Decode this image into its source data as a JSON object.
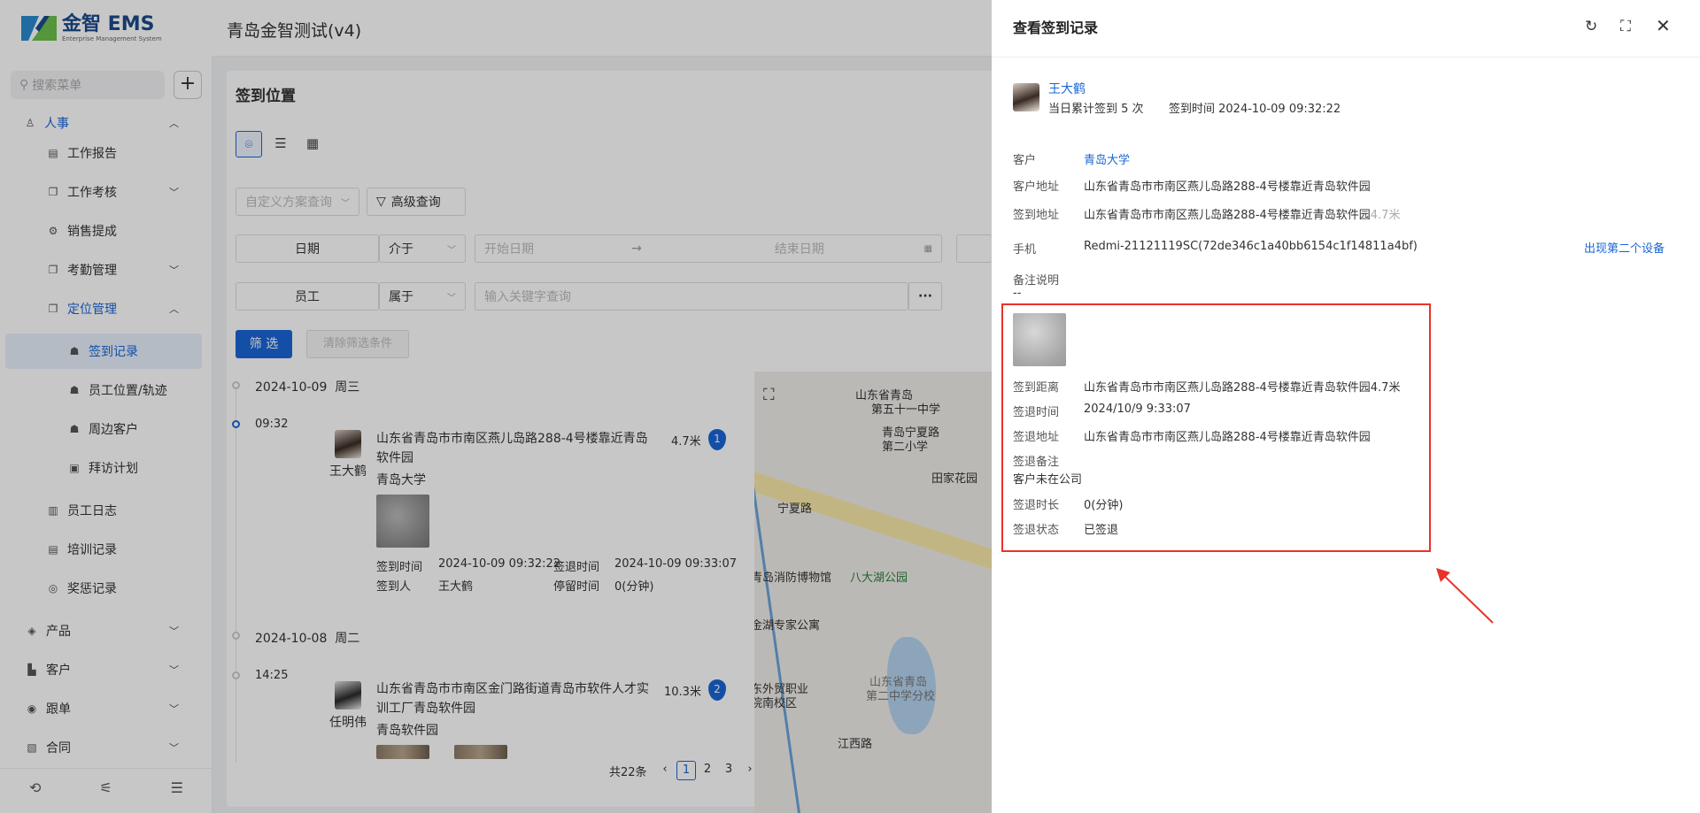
{
  "app": {
    "logo_main": "金智 EMS",
    "logo_sub": "Enterprise Management System",
    "tenant": "青岛金智测试(v4)"
  },
  "sidebar": {
    "search_placeholder": "搜索菜单",
    "add_label": "+",
    "items": [
      {
        "label": "人事",
        "level": 1,
        "expanded": true
      },
      {
        "label": "工作报告",
        "level": 2
      },
      {
        "label": "工作考核",
        "level": 2,
        "has_children": true
      },
      {
        "label": "销售提成",
        "level": 2
      },
      {
        "label": "考勤管理",
        "level": 2,
        "has_children": true
      },
      {
        "label": "定位管理",
        "level": 2,
        "expanded": true
      },
      {
        "label": "签到记录",
        "level": 3,
        "active": true
      },
      {
        "label": "员工位置/轨迹",
        "level": 3
      },
      {
        "label": "周边客户",
        "level": 3
      },
      {
        "label": "拜访计划",
        "level": 3
      },
      {
        "label": "员工日志",
        "level": 2
      },
      {
        "label": "培训记录",
        "level": 2
      },
      {
        "label": "奖惩记录",
        "level": 2
      },
      {
        "label": "产品",
        "level": 1,
        "has_children": true
      },
      {
        "label": "客户",
        "level": 1,
        "has_children": true
      },
      {
        "label": "跟单",
        "level": 1,
        "has_children": true
      },
      {
        "label": "合同",
        "level": 1,
        "has_children": true
      }
    ]
  },
  "page": {
    "title": "签到位置",
    "filters": {
      "scheme_placeholder": "自定义方案查询",
      "advanced": "高级查询",
      "date_label": "日期",
      "date_op": "介于",
      "start_ph": "开始日期",
      "end_ph": "结束日期",
      "emp_label": "员工",
      "emp_op": "属于",
      "kw_ph": "输入关键字查询",
      "more": "···"
    },
    "filter_btn": "筛 选",
    "clear_btn": "清除筛选条件"
  },
  "timeline": {
    "day1": {
      "date": "2024-10-09",
      "weekday": "周三"
    },
    "rec1": {
      "time": "09:32",
      "name": "王大鹤",
      "addr": "山东省青岛市市南区燕儿岛路288-4号楼靠近青岛软件园",
      "dist": "4.7米",
      "badge": "1",
      "customer": "青岛大学",
      "checkin_label": "签到时间",
      "checkin_val": "2024-10-09 09:32:22",
      "checkout_label": "签退时间",
      "checkout_val": "2024-10-09 09:33:07",
      "person_label": "签到人",
      "person_val": "王大鹤",
      "stay_label": "停留时间",
      "stay_val": "0(分钟)"
    },
    "day2": {
      "date": "2024-10-08",
      "weekday": "周二"
    },
    "rec2": {
      "time": "14:25",
      "name": "任明伟",
      "addr": "山东省青岛市市南区金门路街道青岛市软件人才实训工厂青岛软件园",
      "dist": "10.3米",
      "badge": "2",
      "customer": "青岛软件园"
    }
  },
  "map": {
    "labels": [
      "山东省青岛",
      "第五十一中学",
      "青岛宁夏路",
      "第二小学",
      "田家花园",
      "宁夏路",
      "青岛消防博物馆",
      "八大湖公园",
      "金湖专家公寓",
      "东外贸职业",
      "院南校区",
      "山东省青岛",
      "第二中学分校",
      "江西路"
    ],
    "road_label": "宁夏路"
  },
  "pager": {
    "total": "共22条",
    "pages": [
      "1",
      "2",
      "3"
    ],
    "current": "1",
    "prev": "‹",
    "next": "›"
  },
  "drawer": {
    "title": "查看签到记录",
    "name": "王大鹤",
    "summary": "当日累计签到 5 次",
    "checkin": "签到时间 2024-10-09 09:32:22",
    "rows": {
      "customer_label": "客户",
      "customer_val": "青岛大学",
      "cust_addr_label": "客户地址",
      "cust_addr_val": "山东省青岛市市南区燕儿岛路288-4号楼靠近青岛软件园",
      "sign_addr_label": "签到地址",
      "sign_addr_val": "山东省青岛市市南区燕儿岛路288-4号楼靠近青岛软件园",
      "sign_addr_dist": "4.7米",
      "phone_label": "手机",
      "phone_val": "Redmi-21121119SC(72de346c1a40bb6154c1f14811a4bf)",
      "second_device": "出现第二个设备",
      "remark_label": "备注说明",
      "remark_val": "--",
      "dist_label": "签到距离",
      "dist_val": "山东省青岛市市南区燕儿岛路288-4号楼靠近青岛软件园4.7米",
      "out_time_label": "签退时间",
      "out_time_val": "2024/10/9 9:33:07",
      "out_addr_label": "签退地址",
      "out_addr_val": "山东省青岛市市南区燕儿岛路288-4号楼靠近青岛软件园",
      "out_remark_label": "签退备注",
      "out_remark_val": "客户未在公司",
      "duration_label": "签退时长",
      "duration_val": "0(分钟)",
      "status_label": "签退状态",
      "status_val": "已签退"
    }
  },
  "colors": {
    "primary": "#1a66d6",
    "highlight": "#e8332a"
  }
}
